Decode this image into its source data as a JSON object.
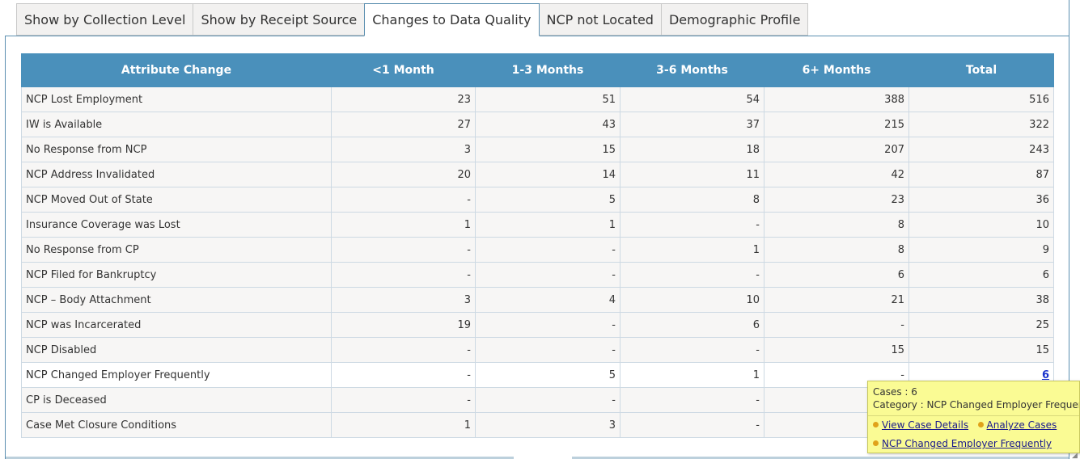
{
  "tabs": [
    {
      "label": "Show by Collection Level",
      "active": false
    },
    {
      "label": "Show by Receipt Source",
      "active": false
    },
    {
      "label": "Changes to Data Quality",
      "active": true
    },
    {
      "label": "NCP not Located",
      "active": false
    },
    {
      "label": "Demographic Profile",
      "active": false
    }
  ],
  "table": {
    "columns": [
      "Attribute Change",
      "<1 Month",
      "1-3 Months",
      "3-6 Months",
      "6+ Months",
      "Total"
    ],
    "rows": [
      [
        "NCP Lost Employment",
        "23",
        "51",
        "54",
        "388",
        "516"
      ],
      [
        "IW is Available",
        "27",
        "43",
        "37",
        "215",
        "322"
      ],
      [
        "No Response from NCP",
        "3",
        "15",
        "18",
        "207",
        "243"
      ],
      [
        "NCP Address Invalidated",
        "20",
        "14",
        "11",
        "42",
        "87"
      ],
      [
        "NCP Moved Out of State",
        "-",
        "5",
        "8",
        "23",
        "36"
      ],
      [
        "Insurance Coverage was Lost",
        "1",
        "1",
        "-",
        "8",
        "10"
      ],
      [
        "No Response from CP",
        "-",
        "-",
        "1",
        "8",
        "9"
      ],
      [
        "NCP Filed for Bankruptcy",
        "-",
        "-",
        "-",
        "6",
        "6"
      ],
      [
        "NCP – Body Attachment",
        "3",
        "4",
        "10",
        "21",
        "38"
      ],
      [
        "NCP was Incarcerated",
        "19",
        "-",
        "6",
        "-",
        "25"
      ],
      [
        "NCP Disabled",
        "-",
        "-",
        "-",
        "15",
        "15"
      ],
      [
        "NCP Changed Employer Frequently",
        "-",
        "5",
        "1",
        "-",
        "6"
      ],
      [
        "CP is Deceased",
        "-",
        "-",
        "-",
        "",
        ""
      ],
      [
        "Case Met Closure Conditions",
        "1",
        "3",
        "-",
        "",
        ""
      ]
    ],
    "highlighted_row": 11
  },
  "tooltip": {
    "cases_line": "Cases : 6",
    "category_line": "Category : NCP Changed Employer Frequently",
    "view_case_details": "View Case Details",
    "analyze_cases": "Analyze Cases",
    "category_link": "NCP Changed Employer Frequently"
  },
  "colors": {
    "header_bg": "#4a90bb",
    "tooltip_bg": "#fafb94",
    "link_value": "#1a33cc"
  }
}
